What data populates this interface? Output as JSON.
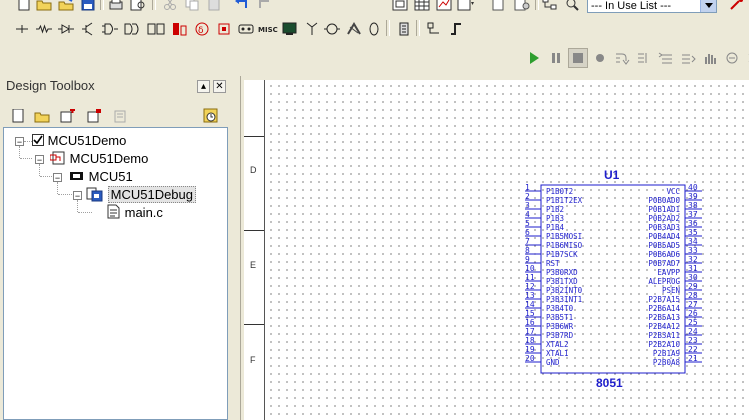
{
  "toolbar": {
    "in_use_list": "--- In Use List ---"
  },
  "panel": {
    "title": "Design Toolbox",
    "min_glyph": "▴",
    "close_glyph": "✕"
  },
  "tree": {
    "items": [
      {
        "label": "MCU51Demo",
        "icon": "checkbox-icon"
      },
      {
        "label": "MCU51Demo",
        "icon": "schematic-icon"
      },
      {
        "label": "MCU51",
        "icon": "mcu-chip-icon"
      },
      {
        "label": "MCU51Debug",
        "icon": "project-build-icon"
      },
      {
        "label": "main.c",
        "icon": "source-file-icon"
      }
    ]
  },
  "ruler": {
    "letters": [
      "D",
      "E",
      "F"
    ]
  },
  "chip": {
    "designator": "U1",
    "part": "8051",
    "left_pins": [
      {
        "num": "1",
        "name": "P1B0T2"
      },
      {
        "num": "2",
        "name": "P1B1T2EX"
      },
      {
        "num": "3",
        "name": "P1B2"
      },
      {
        "num": "4",
        "name": "P1B3"
      },
      {
        "num": "5",
        "name": "P1B4"
      },
      {
        "num": "6",
        "name": "P1B5MOSI"
      },
      {
        "num": "7",
        "name": "P1B6MISO"
      },
      {
        "num": "8",
        "name": "P1B7SCK"
      },
      {
        "num": "9",
        "name": "RST"
      },
      {
        "num": "10",
        "name": "P3B0RXD"
      },
      {
        "num": "11",
        "name": "P3B1TXD"
      },
      {
        "num": "12",
        "name": "P3B2INT0"
      },
      {
        "num": "13",
        "name": "P3B3INT1"
      },
      {
        "num": "14",
        "name": "P3B4T0"
      },
      {
        "num": "15",
        "name": "P3B5T1"
      },
      {
        "num": "16",
        "name": "P3B6WR"
      },
      {
        "num": "17",
        "name": "P3B7RD"
      },
      {
        "num": "18",
        "name": "XTAL2"
      },
      {
        "num": "19",
        "name": "XTAL1"
      },
      {
        "num": "20",
        "name": "GND"
      }
    ],
    "right_pins": [
      {
        "num": "40",
        "name": "VCC"
      },
      {
        "num": "39",
        "name": "P0B0AD0"
      },
      {
        "num": "38",
        "name": "P0B1AD1"
      },
      {
        "num": "37",
        "name": "P0B2AD2"
      },
      {
        "num": "36",
        "name": "P0B3AD3"
      },
      {
        "num": "35",
        "name": "P0B4AD4"
      },
      {
        "num": "34",
        "name": "P0B5AD5"
      },
      {
        "num": "33",
        "name": "P0B6AD6"
      },
      {
        "num": "32",
        "name": "P0B7AD7"
      },
      {
        "num": "31",
        "name": "EAVPP"
      },
      {
        "num": "30",
        "name": "ALEPROG"
      },
      {
        "num": "29",
        "name": "PSEN"
      },
      {
        "num": "28",
        "name": "P2B7A15"
      },
      {
        "num": "27",
        "name": "P2B6A14"
      },
      {
        "num": "26",
        "name": "P2B5A13"
      },
      {
        "num": "25",
        "name": "P2B4A12"
      },
      {
        "num": "24",
        "name": "P2B3A11"
      },
      {
        "num": "23",
        "name": "P2B2A10"
      },
      {
        "num": "22",
        "name": "P2B1A9"
      },
      {
        "num": "21",
        "name": "P2B0A8"
      }
    ]
  }
}
